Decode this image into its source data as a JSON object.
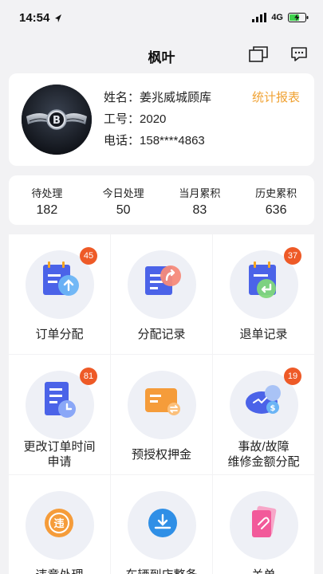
{
  "status": {
    "time": "14:54",
    "network": "4G"
  },
  "header": {
    "title": "枫叶"
  },
  "profile": {
    "name_label": "姓名：",
    "name_value": "姜兆威城顾库",
    "id_label": "工号：",
    "id_value": "2020",
    "phone_label": "电话：",
    "phone_value": "158****4863",
    "report_link": "统计报表"
  },
  "stats": [
    {
      "label": "待处理",
      "value": "182"
    },
    {
      "label": "今日处理",
      "value": "50"
    },
    {
      "label": "当月累积",
      "value": "83"
    },
    {
      "label": "历史累积",
      "value": "636"
    }
  ],
  "tiles": [
    {
      "label": "订单分配",
      "badge": "45",
      "icon": "order-assign-icon"
    },
    {
      "label": "分配记录",
      "badge": "",
      "icon": "assign-record-icon"
    },
    {
      "label": "退单记录",
      "badge": "37",
      "icon": "return-record-icon"
    },
    {
      "label_line1": "更改订单时间",
      "label_line2": "申请",
      "badge": "81",
      "icon": "change-time-icon"
    },
    {
      "label": "预授权押金",
      "badge": "",
      "icon": "deposit-icon"
    },
    {
      "label_line1": "事故/故障",
      "label_line2": "维修金额分配",
      "badge": "19",
      "icon": "repair-allocation-icon"
    },
    {
      "label": "违章处理",
      "badge": "",
      "icon": "violation-icon"
    },
    {
      "label": "车辆到店整备",
      "badge": "",
      "icon": "vehicle-prep-icon"
    },
    {
      "label": "关单",
      "badge": "",
      "icon": "close-order-icon"
    }
  ],
  "colors": {
    "accent": "#f0a233",
    "badge": "#ee5a27",
    "blue": "#4b63e8",
    "orange": "#f59c3a",
    "pink": "#f25a9a"
  }
}
